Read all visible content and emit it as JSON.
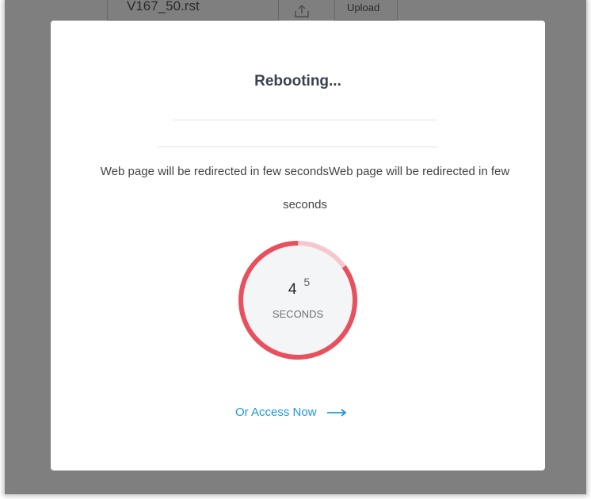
{
  "background": {
    "file_field": "V167_50.rst",
    "upload_label": "Upload"
  },
  "dialog": {
    "title": "Rebooting...",
    "message": "Web page will be redirected in few secondsWeb page will be redirected in few seconds",
    "countdown": {
      "previous_digit": "5",
      "current_value": "4",
      "unit": "SECONDS",
      "progress_fraction": 0.85,
      "ring_color": "#e8505e",
      "ring_track_color": "#f6c7cc"
    },
    "access_link": "Or Access Now",
    "accent_color": "#2196e0"
  }
}
